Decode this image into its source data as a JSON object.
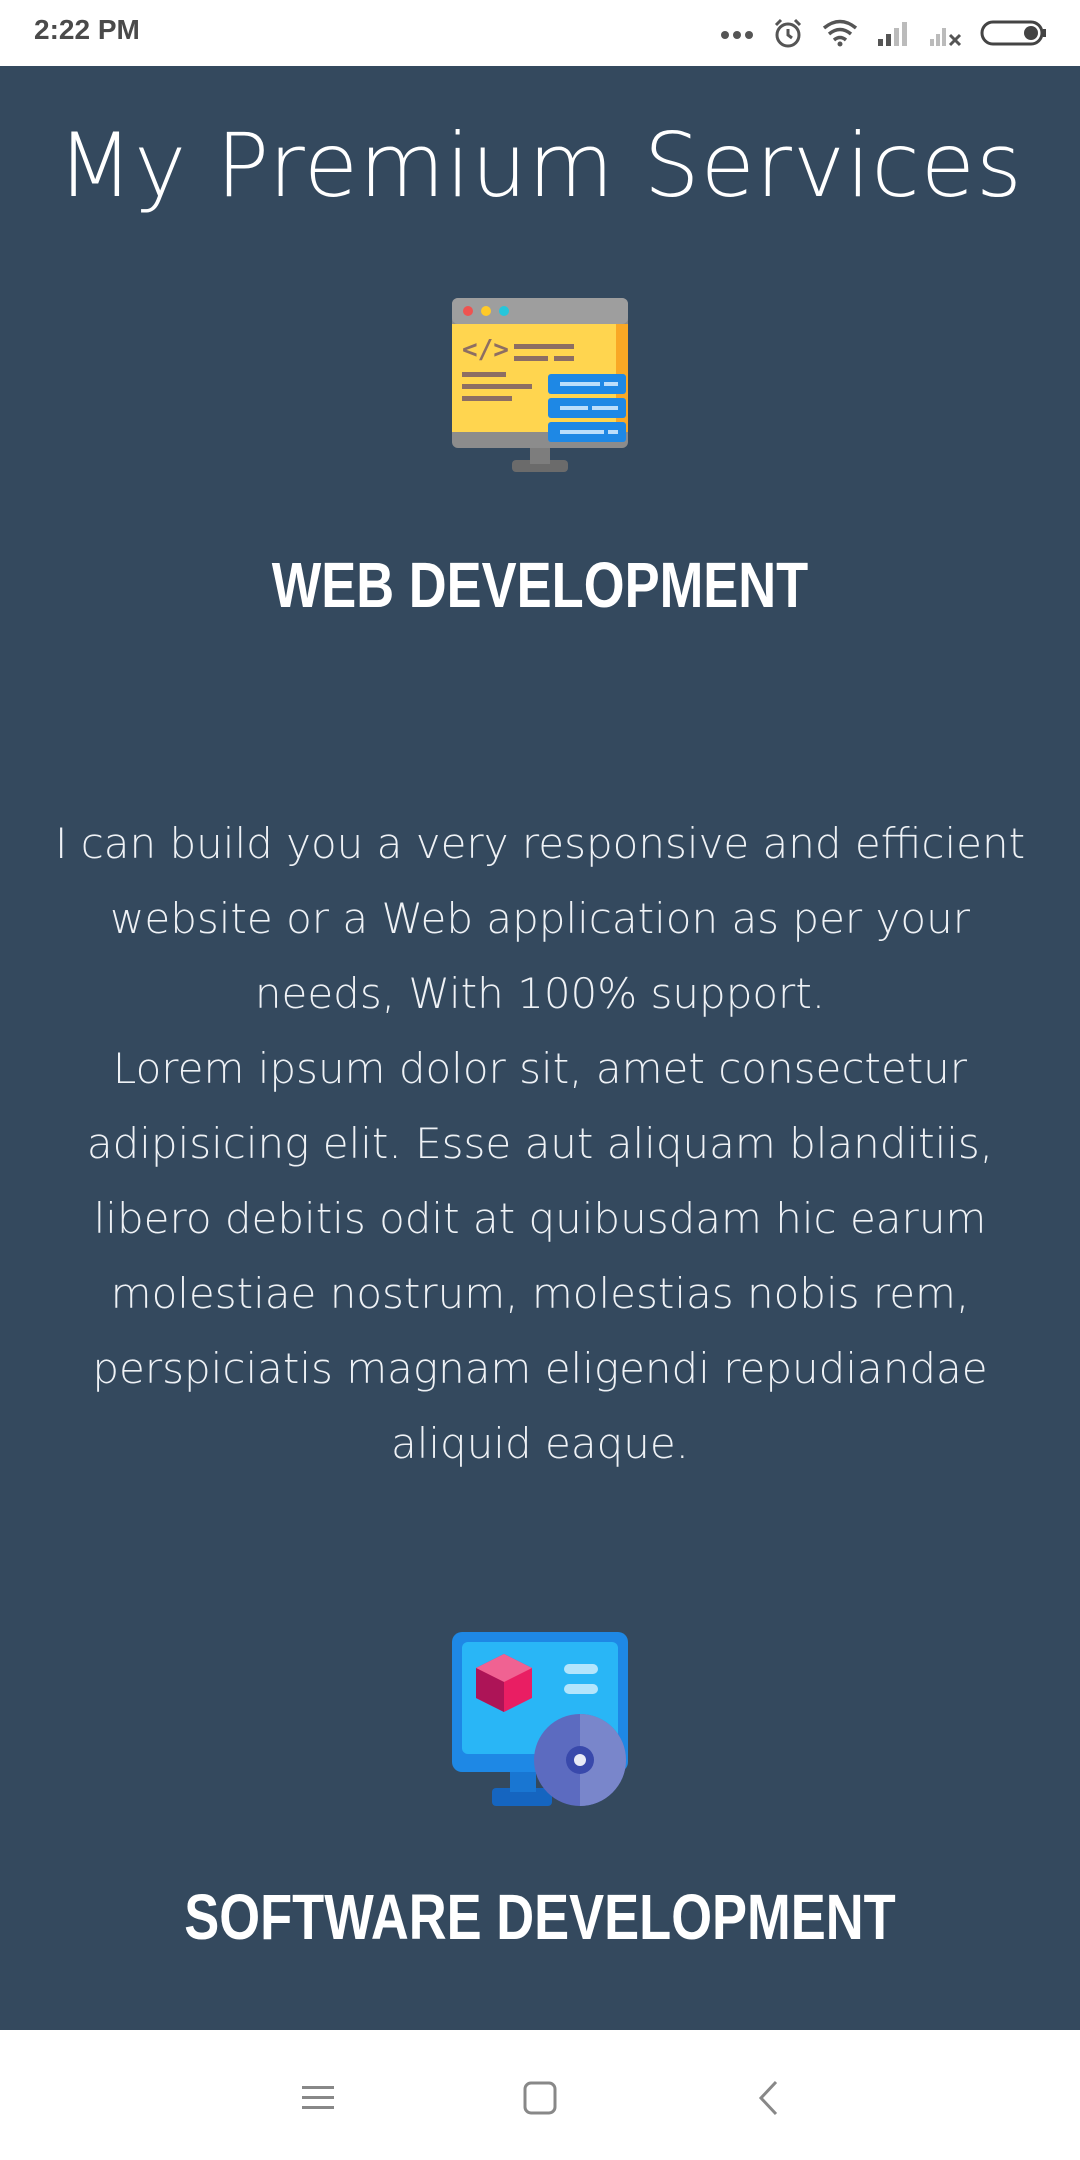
{
  "status_bar": {
    "time": "2:22 PM",
    "icons": [
      "more-dots-icon",
      "alarm-icon",
      "wifi-icon",
      "signal-icon",
      "signal-no-service-icon",
      "battery-icon"
    ]
  },
  "page": {
    "title": "My Premium Services"
  },
  "services": [
    {
      "icon": "web-development-monitor-icon",
      "title": "WEB DEVELOPMENT",
      "description_lines": [
        "I can build you a very responsive and efficient",
        "website or a Web application as per your",
        "needs, With 100% support.",
        "Lorem ipsum dolor sit, amet consectetur",
        "adipisicing elit. Esse aut aliquam blanditiis,",
        "libero debitis odit at quibusdam hic earum",
        "molestiae nostrum, molestias nobis rem,",
        "perspiciatis magnam eligendi repudiandae",
        "aliquid eaque."
      ]
    },
    {
      "icon": "software-development-monitor-icon",
      "title": "SOFTWARE DEVELOPMENT"
    }
  ],
  "nav_bar": {
    "buttons": [
      "menu-icon",
      "home-icon",
      "back-icon"
    ]
  },
  "colors": {
    "background": "#34495e",
    "status_bar": "#ffffff",
    "text": "#ffffff"
  }
}
